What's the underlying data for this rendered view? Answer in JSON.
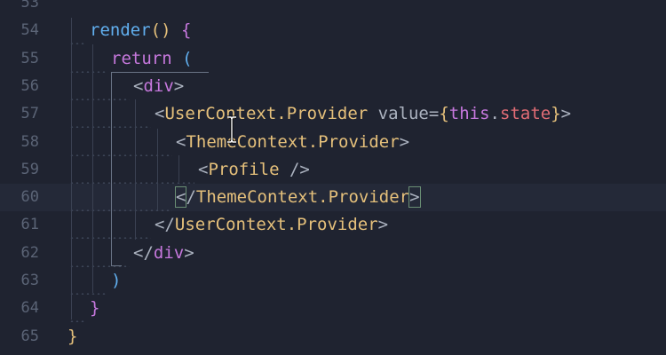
{
  "editor": {
    "lines": [
      {
        "num": "53",
        "tokens": []
      },
      {
        "num": "54",
        "tokens": [
          {
            "t": "render",
            "c": "t-fn"
          },
          {
            "t": "() ",
            "c": "t-paren"
          },
          {
            "t": "{",
            "c": "t-brace1"
          }
        ]
      },
      {
        "num": "55",
        "tokens": [
          {
            "t": "return",
            "c": "t-kw"
          },
          {
            "t": " (",
            "c": "t-paren2"
          }
        ]
      },
      {
        "num": "56",
        "tokens": [
          {
            "t": "<",
            "c": "t-punct"
          },
          {
            "t": "div",
            "c": "t-kw"
          },
          {
            "t": ">",
            "c": "t-punct"
          }
        ]
      },
      {
        "num": "57",
        "tokens": [
          {
            "t": "<",
            "c": "t-punct"
          },
          {
            "t": "UserContext.Provider",
            "c": "t-tag"
          },
          {
            "t": " value",
            "c": "t-attr"
          },
          {
            "t": "=",
            "c": "t-punct"
          },
          {
            "t": "{",
            "c": "t-brace2"
          },
          {
            "t": "this",
            "c": "t-this"
          },
          {
            "t": ".",
            "c": "t-punct"
          },
          {
            "t": "state",
            "c": "t-prop"
          },
          {
            "t": "}",
            "c": "t-brace2"
          },
          {
            "t": ">",
            "c": "t-punct"
          }
        ]
      },
      {
        "num": "58",
        "tokens": [
          {
            "t": "<",
            "c": "t-punct"
          },
          {
            "t": "ThemeContext.Provider",
            "c": "t-tag"
          },
          {
            "t": ">",
            "c": "t-punct"
          }
        ]
      },
      {
        "num": "59",
        "tokens": [
          {
            "t": "<",
            "c": "t-punct"
          },
          {
            "t": "Profile",
            "c": "t-tag"
          },
          {
            "t": " />",
            "c": "t-punct"
          }
        ]
      },
      {
        "num": "60",
        "tokens": [
          {
            "t": "<",
            "c": "t-punct",
            "box": true
          },
          {
            "t": "/",
            "c": "t-punct"
          },
          {
            "t": "ThemeContext.Provider",
            "c": "t-tag"
          },
          {
            "t": ">",
            "c": "t-punct",
            "box": true
          }
        ]
      },
      {
        "num": "61",
        "tokens": [
          {
            "t": "</",
            "c": "t-punct"
          },
          {
            "t": "UserContext.Provider",
            "c": "t-tag"
          },
          {
            "t": ">",
            "c": "t-punct"
          }
        ]
      },
      {
        "num": "62",
        "tokens": [
          {
            "t": "</",
            "c": "t-punct"
          },
          {
            "t": "div",
            "c": "t-kw"
          },
          {
            "t": ">",
            "c": "t-punct"
          }
        ]
      },
      {
        "num": "63",
        "tokens": [
          {
            "t": ")",
            "c": "t-paren2"
          }
        ]
      },
      {
        "num": "64",
        "tokens": [
          {
            "t": "}",
            "c": "t-brace1"
          }
        ]
      },
      {
        "num": "65",
        "tokens": [
          {
            "t": "}",
            "c": "t-brace2"
          }
        ]
      }
    ],
    "current_line": "60",
    "colors": {
      "background": "#1f2330",
      "current_line": "#242938",
      "gutter_text": "#5b6476",
      "keyword": "#c678dd",
      "tag": "#e5c07b",
      "function": "#61afef",
      "property": "#e06c75"
    },
    "cursor_icon": "text-cursor-icon"
  }
}
